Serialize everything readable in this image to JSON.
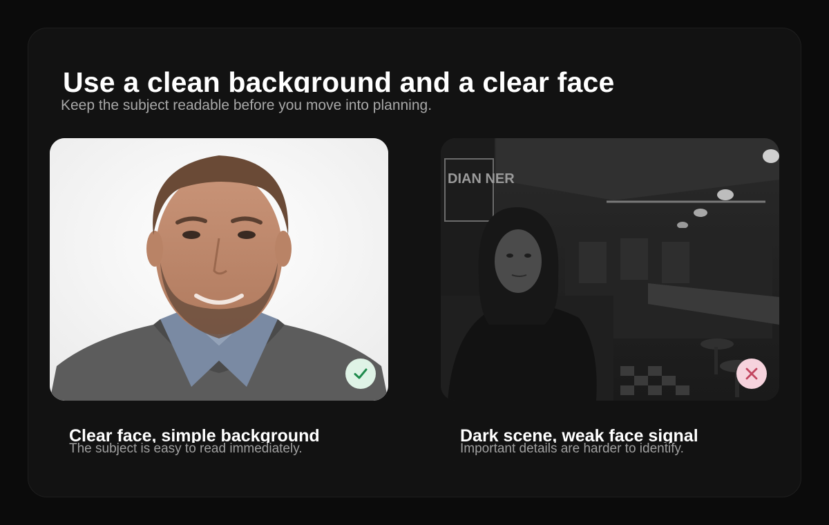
{
  "header": {
    "title": "Use a clean background and a clear face",
    "subtitle": "Keep the subject readable before you move into planning."
  },
  "examples": [
    {
      "kind": "good",
      "image": "portrait-man-white-background",
      "badge_icon": "checkmark-icon",
      "badge_color": "#1e8a4c",
      "title": "Clear face, simple background",
      "description": "The subject is easy to read immediately."
    },
    {
      "kind": "bad",
      "image": "woman-in-dark-diner",
      "sign_text": "DIAN NER",
      "badge_icon": "cross-icon",
      "badge_color": "#c2455f",
      "title": "Dark scene, weak face signal",
      "description": "Important details are harder to identify."
    }
  ],
  "colors": {
    "page_background": "#0b0b0b",
    "panel_background": "#121212",
    "good_badge_background": "#dff3e6",
    "bad_badge_background": "#f6d3dd"
  }
}
